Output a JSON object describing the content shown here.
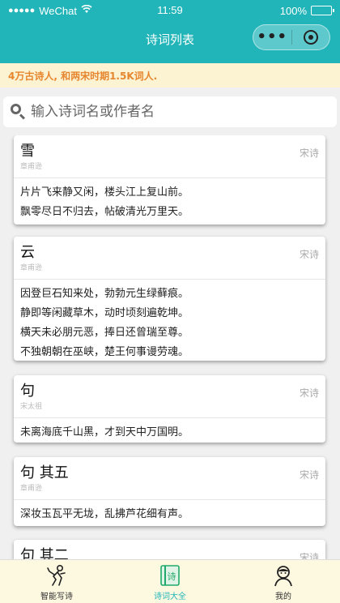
{
  "status_bar": {
    "carrier": "WeChat",
    "time": "11:59",
    "battery": "100%"
  },
  "nav": {
    "title": "诗词列表",
    "more_icon": "more-dots-icon",
    "close_icon": "capsule-close-icon"
  },
  "notice": "4万古诗人, 和两宋时期1.5K词人.",
  "search": {
    "placeholder": "输入诗词名或作者名"
  },
  "poems": [
    {
      "title": "雪",
      "author": "章甫逊",
      "dynasty": "宋诗",
      "lines": [
        "片片飞来静又闲，楼头江上复山前。",
        "飘零尽日不归去，帖破清光万里天。"
      ]
    },
    {
      "title": "云",
      "author": "章甫逊",
      "dynasty": "宋诗",
      "lines": [
        "因登巨石知来处，勃勃元生绿藓痕。",
        "静即等闲藏草木，动时顷刻遍乾坤。",
        "横天未必朋元恶，捧日还曾瑞至尊。",
        "不独朝朝在巫峡，楚王何事谩劳魂。"
      ]
    },
    {
      "title": "句",
      "author": "宋太祖",
      "dynasty": "宋诗",
      "lines": [
        "未离海底千山黑，才到天中万国明。"
      ]
    },
    {
      "title": "句 其五",
      "author": "章甫逊",
      "dynasty": "宋诗",
      "lines": [
        "深妆玉瓦平无垅，乱拂芦花细有声。"
      ]
    },
    {
      "title": "句 其二",
      "author": "",
      "dynasty": "宋诗",
      "lines": []
    }
  ],
  "tabs": [
    {
      "label": "智能写诗",
      "icon": "writing-person-icon",
      "active": false
    },
    {
      "label": "诗词大全",
      "icon": "poem-book-icon",
      "active": true
    },
    {
      "label": "我的",
      "icon": "user-avatar-icon",
      "active": false
    }
  ]
}
